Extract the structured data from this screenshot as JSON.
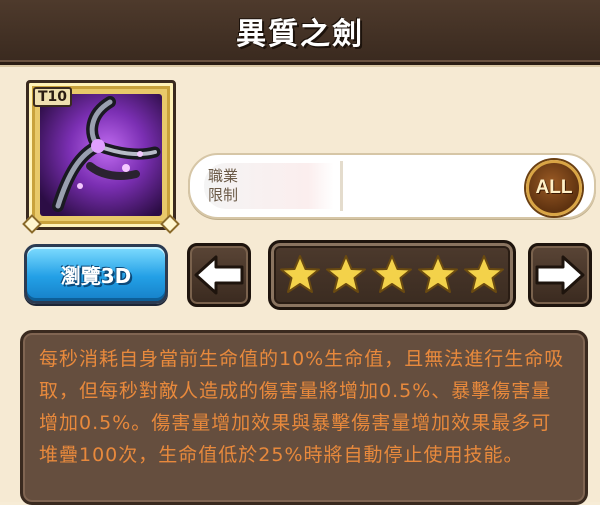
{
  "title": "異質之劍",
  "item": {
    "tier_badge": "T10",
    "icon": "dark-blade-bow-icon"
  },
  "restriction": {
    "label_line1": "職業",
    "label_line2": "限制",
    "value_badge": "ALL"
  },
  "view3d_label": "瀏覽3D",
  "star_rating": 5,
  "star_max": 5,
  "description": "每秒消耗自身當前生命值的10%生命值，且無法進行生命吸取，但每秒對敵人造成的傷害量將增加0.5%、暴擊傷害量增加0.5%。傷害量增加效果與暴擊傷害量增加效果最多可堆疊100次，生命值低於25%時將自動停止使用技能。",
  "colors": {
    "title_bar": "#3a2a1f",
    "description_text": "#e8893c",
    "view3d_button": "#23a0e6",
    "star": "#f3d24a"
  }
}
